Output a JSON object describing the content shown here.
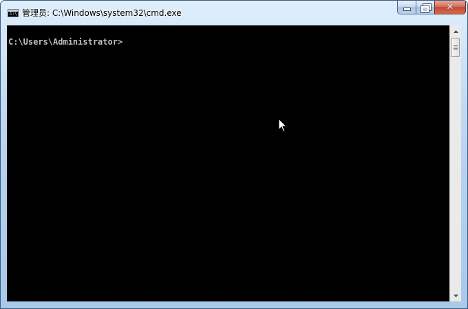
{
  "window": {
    "title": "管理员: C:\\Windows\\system32\\cmd.exe",
    "app_icon_text": "C:\\",
    "app_icon": "cmd-console-icon"
  },
  "caption": {
    "minimize_icon": "minimize-icon",
    "restore_icon": "restore-icon",
    "close_glyph": "✕",
    "close_icon": "close-icon"
  },
  "console": {
    "prompt": "C:\\Users\\Administrator>",
    "background": "#000000",
    "foreground": "#c0c0c0"
  },
  "scrollbar": {
    "up_icon": "scroll-up-arrow-icon",
    "down_icon": "scroll-down-arrow-icon"
  },
  "colors": {
    "close_button": "#c7503a",
    "frame": "#b9d4ef"
  }
}
